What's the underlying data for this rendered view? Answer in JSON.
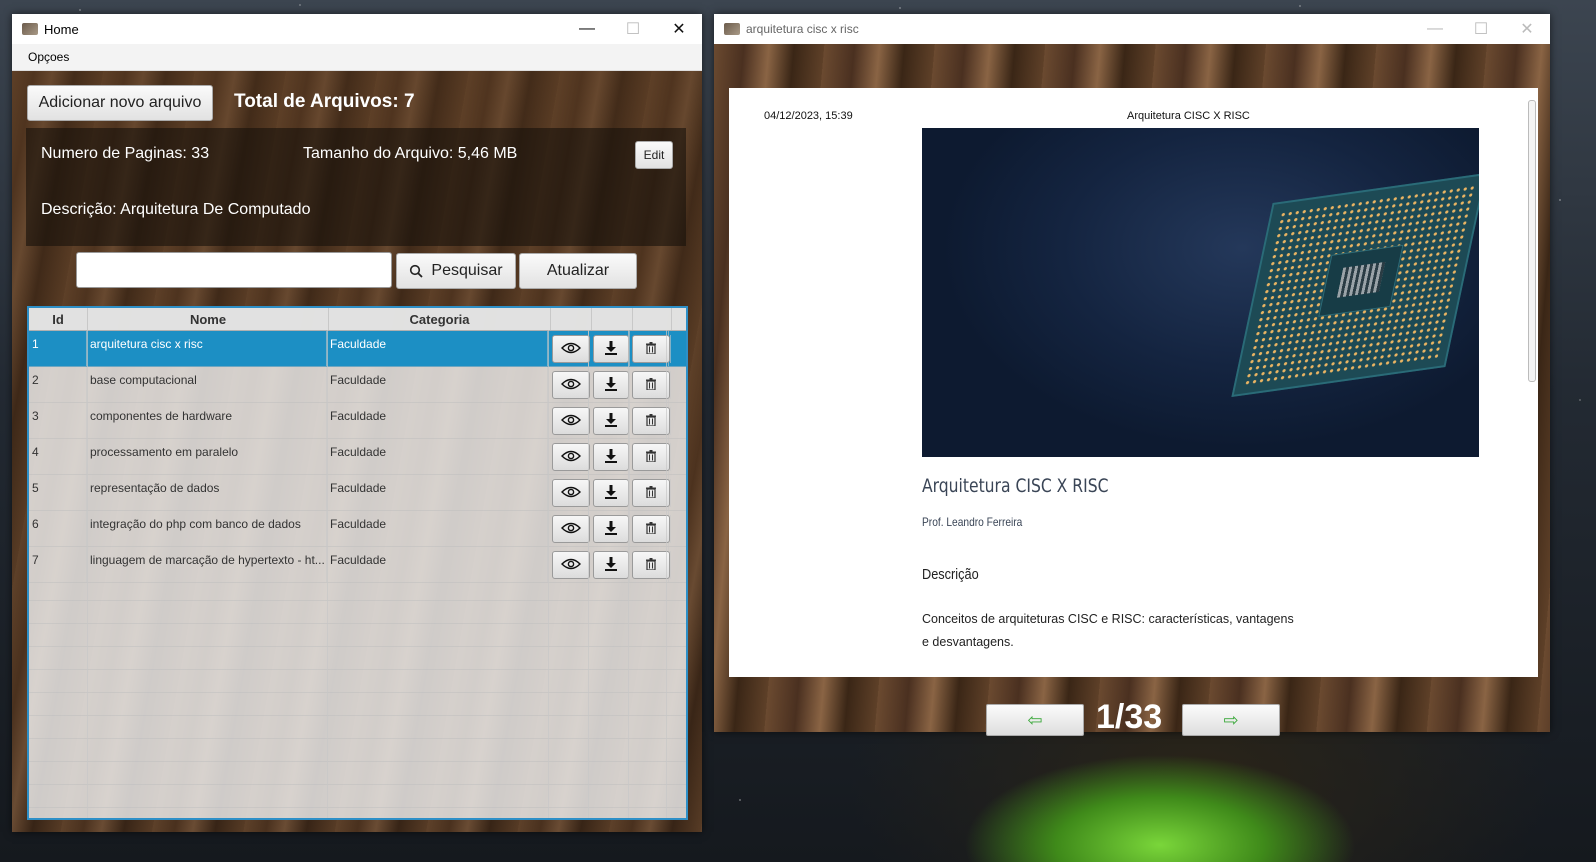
{
  "home_window": {
    "title": "Home",
    "window_controls": [
      "—",
      "☐",
      "✕"
    ],
    "menu": [
      "Opçoes"
    ],
    "add_button": "Adicionar novo arquivo",
    "total_label": "Total de Arquivos: 7",
    "info": {
      "pages": "Numero de Paginas: 33",
      "size": "Tamanho do Arquivo: 5,46 MB",
      "description": "Descrição:  Arquitetura De Computado",
      "edit_button": "Edit"
    },
    "search": {
      "placeholder": "",
      "value": ""
    },
    "search_button": "Pesquisar",
    "refresh_button": "Atualizar",
    "table": {
      "headers": [
        "Id",
        "Nome",
        "Categoria"
      ],
      "rows": [
        {
          "id": "1",
          "nome": "arquitetura cisc x risc",
          "categoria": "Faculdade",
          "selected": true
        },
        {
          "id": "2",
          "nome": "base computacional",
          "categoria": "Faculdade"
        },
        {
          "id": "3",
          "nome": "componentes de hardware",
          "categoria": "Faculdade"
        },
        {
          "id": "4",
          "nome": "processamento em paralelo",
          "categoria": "Faculdade"
        },
        {
          "id": "5",
          "nome": "representação de dados",
          "categoria": "Faculdade"
        },
        {
          "id": "6",
          "nome": "integração do php com banco de dados",
          "categoria": "Faculdade"
        },
        {
          "id": "7",
          "nome": "linguagem de marcação de hypertexto - ht...",
          "categoria": "Faculdade"
        }
      ],
      "row_actions": [
        "eye-icon",
        "download-icon",
        "trash-icon"
      ]
    }
  },
  "viewer_window": {
    "title": "arquitetura cisc x risc",
    "page": {
      "date": "04/12/2023, 15:39",
      "header_title": "Arquitetura CISC X RISC",
      "heading": "Arquitetura CISC X RISC",
      "author": "Prof. Leandro Ferreira",
      "section": "Descrição",
      "description": "Conceitos de arquiteturas CISC e RISC: características, vantagens e desvantagens."
    },
    "page_indicator": "1/33",
    "prev_icon": "⇦",
    "next_icon": "⇨"
  },
  "colors": {
    "selection": "#1c8fc4",
    "table_border": "#2d8fc7",
    "nav_arrow": "#3aa83a"
  }
}
